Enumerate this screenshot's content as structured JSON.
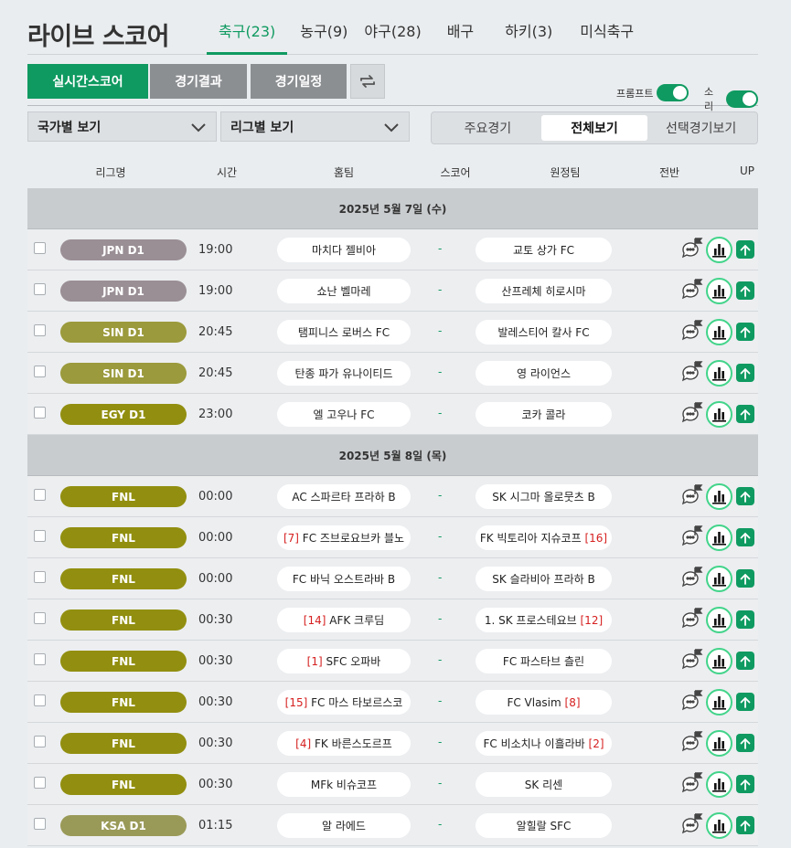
{
  "header": {
    "title": "라이브 스코어",
    "tabs": [
      {
        "label": "축구(23)",
        "active": true
      },
      {
        "label": "농구(9)",
        "active": false
      },
      {
        "label": "야구(28)",
        "active": false
      },
      {
        "label": "배구",
        "active": false
      },
      {
        "label": "하키(3)",
        "active": false
      },
      {
        "label": "미식축구",
        "active": false
      }
    ]
  },
  "toolbar": {
    "live_label": "실시간스코어",
    "results_label": "경기결과",
    "schedule_label": "경기일정",
    "refresh_icon": "refresh-icon",
    "prompt_label": "프롬프트",
    "prompt_on": true,
    "sound_label": "소리",
    "sound_on": true
  },
  "filters": {
    "country_select": "국가별 보기",
    "league_select": "리그별 보기",
    "segments": [
      {
        "label": "주요경기",
        "active": false
      },
      {
        "label": "전체보기",
        "active": true
      },
      {
        "label": "선택경기보기",
        "active": false
      }
    ]
  },
  "columns": {
    "league": "리그명",
    "time": "시간",
    "home": "홈팀",
    "score": "스코어",
    "away": "원정팀",
    "half": "전반",
    "up": "UP"
  },
  "colors": {
    "accent": "#0f9a61",
    "rank": "#d62020",
    "league_jpn": "#9a8f95",
    "league_sin": "#9b9a3c",
    "league_egy": "#928f10",
    "league_fnl": "#928f10",
    "league_ksa": "#9a9a58"
  },
  "groups": [
    {
      "date": "2025년 5월 7일 (수)",
      "matches": [
        {
          "league": "JPN D1",
          "color": "#9a8f95",
          "time": "19:00",
          "home": "마치다 젤비아",
          "home_rank": "",
          "score": "-",
          "away": "교토 상가 FC",
          "away_rank": ""
        },
        {
          "league": "JPN D1",
          "color": "#9a8f95",
          "time": "19:00",
          "home": "쇼난 벨마레",
          "home_rank": "",
          "score": "-",
          "away": "산프레체 히로시마",
          "away_rank": ""
        },
        {
          "league": "SIN D1",
          "color": "#9b9a3c",
          "time": "20:45",
          "home": "탬피니스 로버스 FC",
          "home_rank": "",
          "score": "-",
          "away": "발레스티어 칼사 FC",
          "away_rank": ""
        },
        {
          "league": "SIN D1",
          "color": "#9b9a3c",
          "time": "20:45",
          "home": "탄종 파가 유나이티드",
          "home_rank": "",
          "score": "-",
          "away": "영 라이언스",
          "away_rank": ""
        },
        {
          "league": "EGY D1",
          "color": "#928f10",
          "time": "23:00",
          "home": "엘 고우나 FC",
          "home_rank": "",
          "score": "-",
          "away": "코카 콜라",
          "away_rank": ""
        }
      ]
    },
    {
      "date": "2025년 5월 8일 (목)",
      "matches": [
        {
          "league": "FNL",
          "color": "#928f10",
          "time": "00:00",
          "home": "AC 스파르타 프라하 B",
          "home_rank": "",
          "score": "-",
          "away": "SK 시그마 올로뭇츠 B",
          "away_rank": ""
        },
        {
          "league": "FNL",
          "color": "#928f10",
          "time": "00:00",
          "home": "FC 즈브로요브카 블노",
          "home_rank": "[7]",
          "score": "-",
          "away": "FK 빅토리아 지슈코프",
          "away_rank": "[16]"
        },
        {
          "league": "FNL",
          "color": "#928f10",
          "time": "00:00",
          "home": "FC 바닉 오스트라바 B",
          "home_rank": "",
          "score": "-",
          "away": "SK 슬라비아 프라하 B",
          "away_rank": ""
        },
        {
          "league": "FNL",
          "color": "#928f10",
          "time": "00:30",
          "home": "AFK 크루딤",
          "home_rank": "[14]",
          "score": "-",
          "away": "1. SK 프로스테요브",
          "away_rank": "[12]"
        },
        {
          "league": "FNL",
          "color": "#928f10",
          "time": "00:30",
          "home": "SFC 오파바",
          "home_rank": "[1]",
          "score": "-",
          "away": "FC 파스타브 츨린",
          "away_rank": ""
        },
        {
          "league": "FNL",
          "color": "#928f10",
          "time": "00:30",
          "home": "FC 마스 타보르스코",
          "home_rank": "[15]",
          "score": "-",
          "away": "FC Vlasim",
          "away_rank": "[8]"
        },
        {
          "league": "FNL",
          "color": "#928f10",
          "time": "00:30",
          "home": "FK 바른스도르프",
          "home_rank": "[4]",
          "score": "-",
          "away": "FC 비소치나 이흘라바",
          "away_rank": "[2]"
        },
        {
          "league": "FNL",
          "color": "#928f10",
          "time": "00:30",
          "home": "MFk 비슈코프",
          "home_rank": "",
          "score": "-",
          "away": "SK 리센",
          "away_rank": ""
        },
        {
          "league": "KSA D1",
          "color": "#9a9a58",
          "time": "01:15",
          "home": "알 라에드",
          "home_rank": "",
          "score": "-",
          "away": "알힐랄 SFC",
          "away_rank": ""
        }
      ]
    }
  ]
}
